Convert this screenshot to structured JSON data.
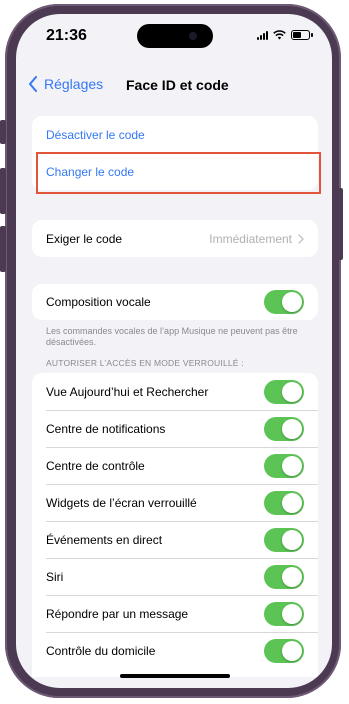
{
  "status_bar": {
    "time": "21:36"
  },
  "nav": {
    "back_label": "Réglages",
    "title": "Face ID et code"
  },
  "passcode_group": {
    "items": [
      {
        "label": "Désactiver le code"
      },
      {
        "label": "Changer le code"
      }
    ]
  },
  "require_group": {
    "label": "Exiger le code",
    "value": "Immédiatement"
  },
  "voice_dial": {
    "label": "Composition vocale",
    "enabled": true,
    "footnote": "Les commandes vocales de l’app Musique ne peuvent pas être désactivées."
  },
  "locked_access": {
    "header": "AUTORISER L’ACCÈS EN MODE VERROUILLÉ :",
    "items": [
      {
        "label": "Vue Aujourd’hui et Rechercher",
        "enabled": true
      },
      {
        "label": "Centre de notifications",
        "enabled": true
      },
      {
        "label": "Centre de contrôle",
        "enabled": true
      },
      {
        "label": "Widgets de l’écran verrouillé",
        "enabled": true
      },
      {
        "label": "Événements en direct",
        "enabled": true
      },
      {
        "label": "Siri",
        "enabled": true
      },
      {
        "label": "Répondre par un message",
        "enabled": true
      },
      {
        "label": "Contrôle du domicile",
        "enabled": true
      }
    ]
  },
  "colors": {
    "accent": "#3478f6",
    "toggle_on": "#5cc355",
    "highlight": "#e2553a",
    "frame": "#4c3a52"
  }
}
